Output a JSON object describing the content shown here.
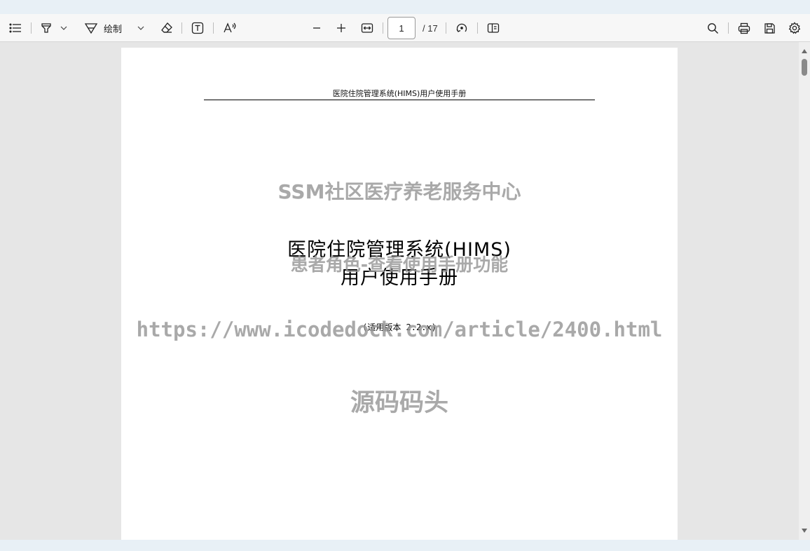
{
  "toolbar": {
    "contents_icon": "list-icon",
    "highlight_icon": "highlighter-icon",
    "draw_label": "绘制",
    "draw_icon": "pen-icon",
    "erase_icon": "eraser-icon",
    "textbox_icon": "text-box-icon",
    "read_aloud_icon": "read-aloud-icon",
    "zoom_out_icon": "minus-icon",
    "zoom_in_icon": "plus-icon",
    "fit_width_icon": "fit-width-icon",
    "page_current": "1",
    "page_total": "/ 17",
    "rotate_icon": "rotate-icon",
    "two_page_icon": "page-view-icon",
    "search_icon": "search-icon",
    "print_icon": "printer-icon",
    "save_icon": "save-icon",
    "settings_icon": "gear-icon"
  },
  "document": {
    "running_header": "医院住院管理系统(HIMS)用户使用手册",
    "title_line1": "医院住院管理系统(HIMS)",
    "title_line2": "用户使用手册",
    "version": "(适用版本 2.2.x)"
  },
  "watermarks": {
    "line1": "SSM社区医疗养老服务中心",
    "line2": "患者角色-查看使用手册功能",
    "line3": "https://www.icodedock.com/article/2400.html",
    "line4": "源码码头"
  }
}
